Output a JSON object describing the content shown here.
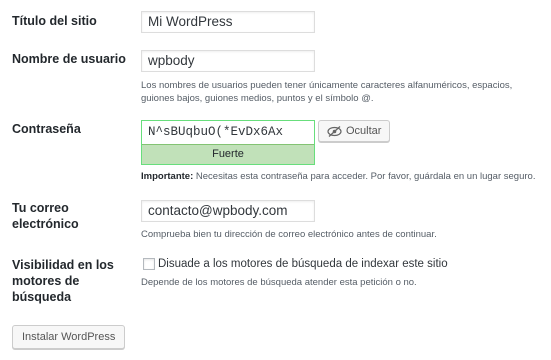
{
  "site_title": {
    "label": "Título del sitio",
    "value": "Mi WordPress"
  },
  "username": {
    "label": "Nombre de usuario",
    "value": "wpbody",
    "description": "Los nombres de usuarios pueden tener únicamente caracteres alfanuméricos, espacios, guiones bajos, guiones medios, puntos y el símbolo @."
  },
  "password": {
    "label": "Contraseña",
    "value": "N^sBUqbuO(*EvDx6Ax",
    "strength": "Fuerte",
    "hide_button": "Ocultar",
    "important_label": "Importante:",
    "important_text": " Necesitas esta contraseña para acceder. Por favor, guárdala en un lugar seguro."
  },
  "email": {
    "label": "Tu correo electrónico",
    "value": "contacto@wpbody.com",
    "description": "Comprueba bien tu dirección de correo electrónico antes de continuar."
  },
  "visibility": {
    "label": "Visibilidad en los motores de búsqueda",
    "checkbox_label": "Disuade a los motores de búsqueda de indexar este sitio",
    "checked": false,
    "description": "Depende de los motores de búsqueda atender esta petición o no."
  },
  "install_button": "Instalar WordPress",
  "icons": {
    "hide": "eye-slash-icon"
  },
  "colors": {
    "strength_bg": "#c1e1b9",
    "strength_border": "#68de7c"
  }
}
